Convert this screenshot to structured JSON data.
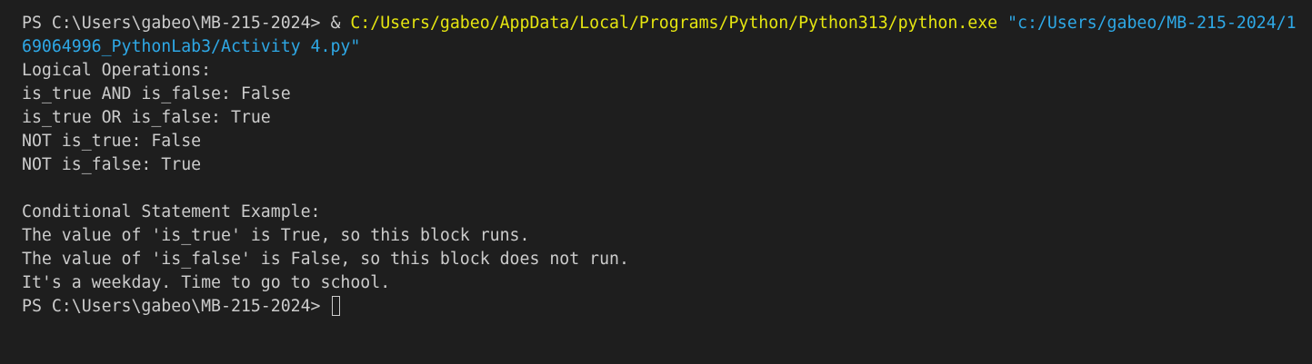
{
  "terminal": {
    "command": {
      "prompt": "PS C:\\Users\\gabeo\\MB-215-2024> ",
      "operator": "& ",
      "executable": "C:/Users/gabeo/AppData/Local/Programs/Python/Python313/python.exe",
      "argument_line1": " \"c:/Users/gabeo/MB-215-2024/1",
      "argument_line2": "69064996_PythonLab3/Activity 4.py\""
    },
    "output": [
      "Logical Operations:",
      "is_true AND is_false: False",
      "is_true OR is_false: True",
      "NOT is_true: False",
      "NOT is_false: True",
      "",
      "Conditional Statement Example:",
      "The value of 'is_true' is True, so this block runs.",
      "The value of 'is_false' is False, so this block does not run.",
      "It's a weekday. Time to go to school."
    ],
    "final_prompt": "PS C:\\Users\\gabeo\\MB-215-2024> "
  }
}
